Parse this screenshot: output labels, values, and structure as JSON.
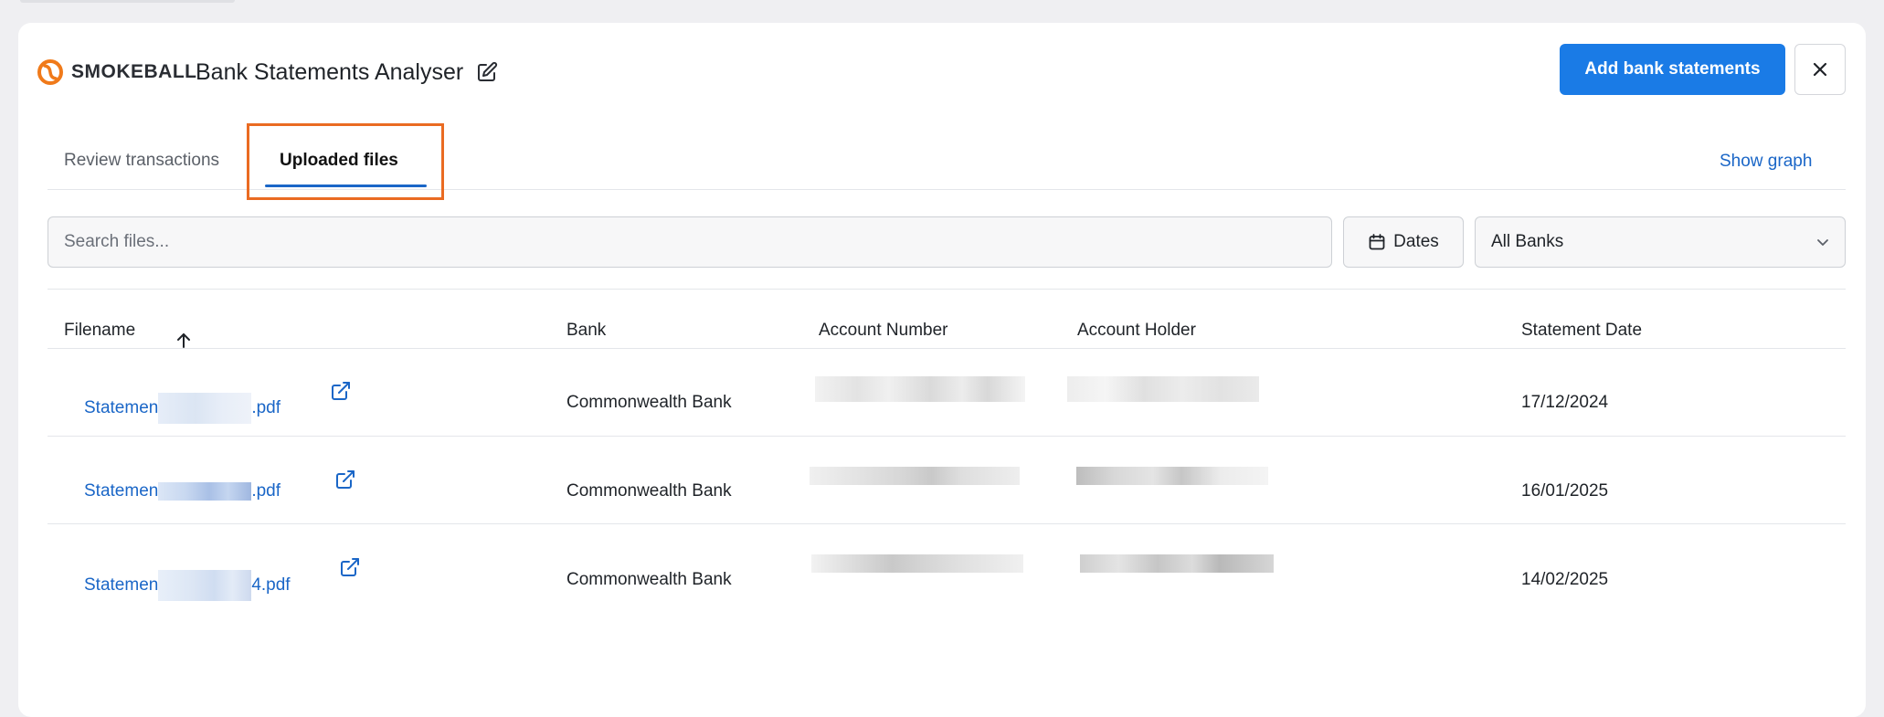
{
  "app": {
    "brand": "SMOKEBALL",
    "title": "Bank Statements Analyser",
    "add_button": "Add bank statements"
  },
  "tabs": [
    {
      "label": "Review transactions",
      "active": false
    },
    {
      "label": "Uploaded files",
      "active": true
    }
  ],
  "show_graph": "Show graph",
  "filters": {
    "search_placeholder": "Search files...",
    "dates_label": "Dates",
    "bank_selected": "All Banks"
  },
  "table": {
    "columns": [
      "Filename",
      "Bank",
      "Account Number",
      "Account Holder",
      "Statement Date"
    ],
    "sort": {
      "column": "Filename",
      "direction": "ascending"
    },
    "rows": [
      {
        "filename_prefix": "Statemen",
        "filename_suffix": ".pdf",
        "bank": "Commonwealth Bank",
        "statement_date": "17/12/2024"
      },
      {
        "filename_prefix": "Statemen",
        "filename_suffix": ".pdf",
        "bank": "Commonwealth Bank",
        "statement_date": "16/01/2025"
      },
      {
        "filename_prefix": "Statemen",
        "filename_suffix": "4.pdf",
        "bank": "Commonwealth Bank",
        "statement_date": "14/02/2025"
      }
    ]
  },
  "colors": {
    "accent": "#1a7be6",
    "link": "#1a66c7",
    "highlight": "#ea6b22",
    "logo": "#f07a1a"
  },
  "icons": [
    "smokeball-logo-icon",
    "edit-icon",
    "close-icon",
    "calendar-icon",
    "chevron-down-icon",
    "sort-arrow-up-icon",
    "external-link-icon"
  ]
}
